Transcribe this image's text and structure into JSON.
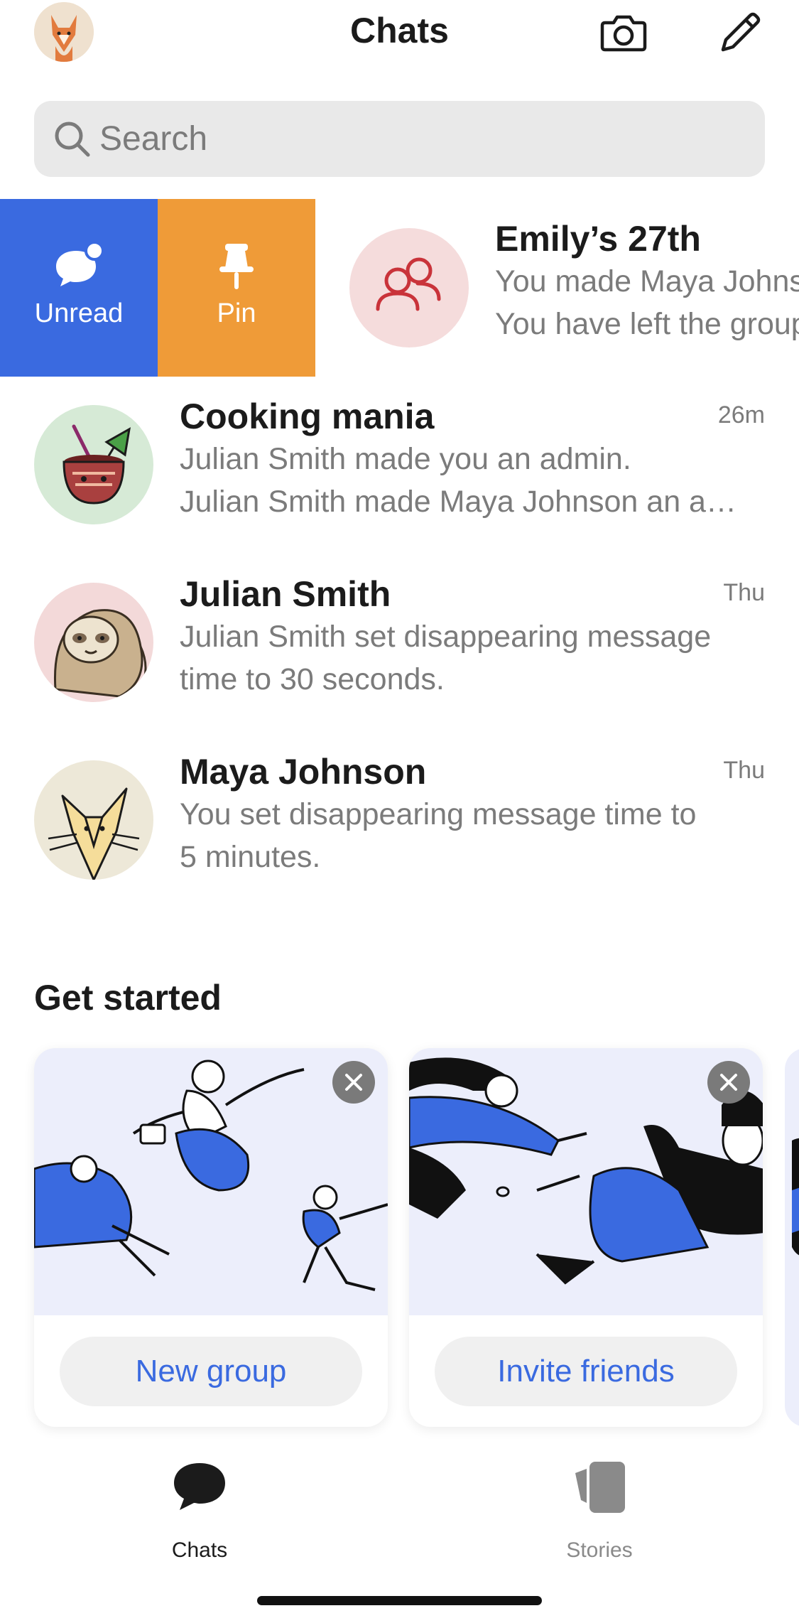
{
  "header": {
    "title": "Chats"
  },
  "search": {
    "placeholder": "Search"
  },
  "swipe_actions": {
    "unread_label": "Unread",
    "pin_label": "Pin"
  },
  "chats": [
    {
      "name": "Emily’s 27th",
      "time": "",
      "line1": "You made Maya Johnson an admin.",
      "line2": "You have left the group.",
      "avatar": "group-icon"
    },
    {
      "name": "Cooking mania",
      "time": "26m",
      "line1": "Julian Smith made you an admin.",
      "line2": "Julian Smith made Maya Johnson an a…",
      "avatar": "coconut-drink"
    },
    {
      "name": "Julian Smith",
      "time": "Thu",
      "line1": "Julian  Smith set disappearing message",
      "line2": "time to 30 seconds.",
      "avatar": "sloth"
    },
    {
      "name": "Maya Johnson",
      "time": "Thu",
      "line1": "You set disappearing message time to",
      "line2": "5 minutes.",
      "avatar": "fox"
    }
  ],
  "get_started": {
    "title": "Get started",
    "cards": [
      {
        "cta": "New group"
      },
      {
        "cta": "Invite friends"
      }
    ]
  },
  "tabbar": {
    "chats_label": "Chats",
    "stories_label": "Stories"
  },
  "colors": {
    "accent_blue": "#3a6ae0",
    "pin_orange": "#ef9b38",
    "secondary_text": "#7b7b7b",
    "search_bg": "#e9e9e9"
  }
}
